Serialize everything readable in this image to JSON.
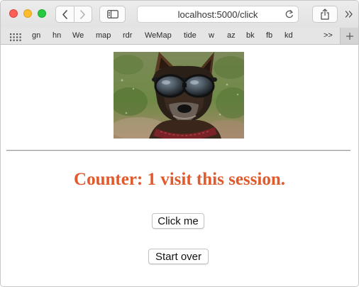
{
  "browser": {
    "address": "localhost:5000/click",
    "bookmarks": [
      "gn",
      "hn",
      "We",
      "map",
      "rdr",
      "WeMap",
      "tide",
      "w",
      "az",
      "bk",
      "fb",
      "kd"
    ],
    "overflow_label": ">>"
  },
  "page": {
    "counter_text": "Counter: 1 visit this session.",
    "click_button_label": "Click me",
    "start_over_label": "Start over"
  },
  "colors": {
    "counter": "#e05a2c",
    "close": "#fc5f57",
    "minimize": "#fdbc2e",
    "maximize": "#28c840"
  }
}
